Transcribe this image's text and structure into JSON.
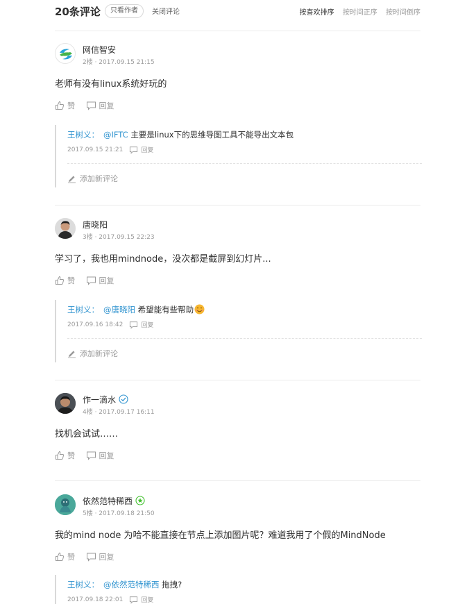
{
  "header": {
    "count_label": "20条评论",
    "only_author_label": "只看作者",
    "close_comments_label": "关闭评论",
    "sort": [
      {
        "label": "按喜欢排序",
        "active": true
      },
      {
        "label": "按时间正序",
        "active": false
      },
      {
        "label": "按时间倒序",
        "active": false
      }
    ]
  },
  "labels": {
    "like": "赞",
    "reply": "回复",
    "add_comment": "添加新评论"
  },
  "comments": [
    {
      "user": "网信智安",
      "meta": "2楼 · 2017.09.15 21:15",
      "text": "老师有没有linux系统好玩的",
      "replies": [
        {
          "author": "王树义：",
          "mention": "@IFTC",
          "text": " 主要是linux下的思维导图工具不能导出文本包",
          "time": "2017.09.15 21:21"
        }
      ]
    },
    {
      "user": "唐晓阳",
      "meta": "3楼 · 2017.09.15 22:23",
      "text": "学习了，我也用mindnode，没次都是截屏到幻灯片...",
      "replies": [
        {
          "author": "王树义：",
          "mention": "@唐晓阳",
          "text": " 希望能有些帮助",
          "time": "2017.09.16 18:42"
        }
      ]
    },
    {
      "user": "作一滴水",
      "meta": "4楼 · 2017.09.17 16:11",
      "text": "找机会试试……",
      "replies": []
    },
    {
      "user": "依然范特稀西",
      "meta": "5楼 · 2017.09.18 21:50",
      "text": "我的mind node 为哈不能直接在节点上添加图片呢？难道我用了个假的MindNode",
      "replies": [
        {
          "author": "王树义：",
          "mention": "@依然范特稀西",
          "text": " 拖拽?",
          "time": "2017.09.18 22:01"
        }
      ]
    }
  ],
  "colors": {
    "link": "#3194d0",
    "muted": "#9b9b9b",
    "text": "#2f2f2f",
    "verified": "#3194d0",
    "star_badge": "#42c02e"
  }
}
